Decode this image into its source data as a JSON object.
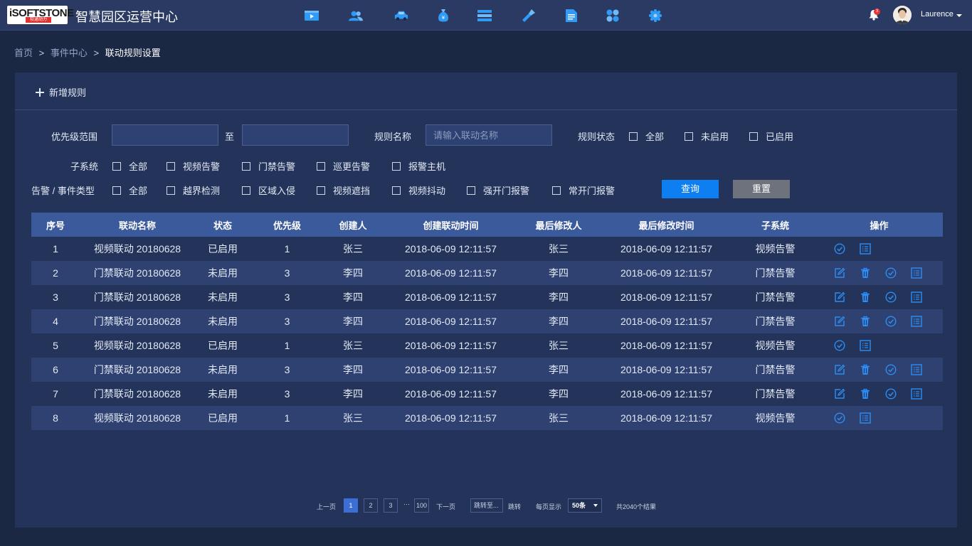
{
  "header": {
    "logo_text": "iSOFTSTONE",
    "logo_sub": "软通动力",
    "app_title": "智慧园区运营中心",
    "nav_icons": [
      "video-icon",
      "users-icon",
      "car-icon",
      "money-bag-icon",
      "layers-icon",
      "tool-icon",
      "document-icon",
      "apps-icon",
      "settings-icon"
    ],
    "notification_count": "3",
    "username": "Laurence"
  },
  "breadcrumb": {
    "home": "首页",
    "sep1": ">",
    "events": "事件中心",
    "sep2": ">",
    "current": "联动规则设置"
  },
  "toolbar": {
    "add_rule": "新增规则"
  },
  "filters": {
    "priority_label": "优先级范围",
    "priority_to": "至",
    "priority_from_value": "",
    "priority_to_value": "",
    "rule_name_label": "规则名称",
    "rule_name_placeholder": "请输入联动名称",
    "rule_status_label": "规则状态",
    "status_options": [
      "全部",
      "未启用",
      "已启用"
    ],
    "subsystem_label": "子系统",
    "subsystem_options": [
      "全部",
      "视频告警",
      "门禁告警",
      "巡更告警",
      "报警主机"
    ],
    "alarm_type_label": "告警 / 事件类型",
    "alarm_type_options": [
      "全部",
      "越界检测",
      "区域入侵",
      "视频遮挡",
      "视频抖动",
      "强开门报警",
      "常开门报警"
    ],
    "query_button": "查询",
    "reset_button": "重置"
  },
  "table": {
    "columns": [
      "序号",
      "联动名称",
      "状态",
      "优先级",
      "创建人",
      "创建联动时间",
      "最后修改人",
      "最后修改时间",
      "子系统",
      "操作"
    ],
    "rows": [
      {
        "no": "1",
        "name": "视频联动 20180628",
        "status": "已启用",
        "priority": "1",
        "creator": "张三",
        "created": "2018-06-09 12:11:57",
        "modifier": "张三",
        "modified": "2018-06-09 12:11:57",
        "subsystem": "视频告警",
        "ops": [
          "check-circle-icon",
          "list-icon"
        ]
      },
      {
        "no": "2",
        "name": "门禁联动 20180628",
        "status": "未启用",
        "priority": "3",
        "creator": "李四",
        "created": "2018-06-09 12:11:57",
        "modifier": "李四",
        "modified": "2018-06-09 12:11:57",
        "subsystem": "门禁告警",
        "ops": [
          "edit-icon",
          "trash-icon",
          "check-circle-icon",
          "list-icon"
        ]
      },
      {
        "no": "3",
        "name": "门禁联动 20180628",
        "status": "未启用",
        "priority": "3",
        "creator": "李四",
        "created": "2018-06-09 12:11:57",
        "modifier": "李四",
        "modified": "2018-06-09 12:11:57",
        "subsystem": "门禁告警",
        "ops": [
          "edit-icon",
          "trash-icon",
          "check-circle-icon",
          "list-icon"
        ]
      },
      {
        "no": "4",
        "name": "门禁联动 20180628",
        "status": "未启用",
        "priority": "3",
        "creator": "李四",
        "created": "2018-06-09 12:11:57",
        "modifier": "李四",
        "modified": "2018-06-09 12:11:57",
        "subsystem": "门禁告警",
        "ops": [
          "edit-icon",
          "trash-icon",
          "check-circle-icon",
          "list-icon"
        ]
      },
      {
        "no": "5",
        "name": "视频联动 20180628",
        "status": "已启用",
        "priority": "1",
        "creator": "张三",
        "created": "2018-06-09 12:11:57",
        "modifier": "张三",
        "modified": "2018-06-09 12:11:57",
        "subsystem": "视频告警",
        "ops": [
          "check-circle-icon",
          "list-icon"
        ]
      },
      {
        "no": "6",
        "name": "门禁联动 20180628",
        "status": "未启用",
        "priority": "3",
        "creator": "李四",
        "created": "2018-06-09 12:11:57",
        "modifier": "李四",
        "modified": "2018-06-09 12:11:57",
        "subsystem": "门禁告警",
        "ops": [
          "edit-icon",
          "trash-icon",
          "check-circle-icon",
          "list-icon"
        ]
      },
      {
        "no": "7",
        "name": "门禁联动 20180628",
        "status": "未启用",
        "priority": "3",
        "creator": "李四",
        "created": "2018-06-09 12:11:57",
        "modifier": "李四",
        "modified": "2018-06-09 12:11:57",
        "subsystem": "门禁告警",
        "ops": [
          "edit-icon",
          "trash-icon",
          "check-circle-icon",
          "list-icon"
        ]
      },
      {
        "no": "8",
        "name": "视频联动 20180628",
        "status": "已启用",
        "priority": "1",
        "creator": "张三",
        "created": "2018-06-09 12:11:57",
        "modifier": "张三",
        "modified": "2018-06-09 12:11:57",
        "subsystem": "视频告警",
        "ops": [
          "check-circle-icon",
          "list-icon"
        ]
      }
    ]
  },
  "pagination": {
    "prev": "上一页",
    "pages": [
      "1",
      "2",
      "3"
    ],
    "active_page": "1",
    "ellipsis": "···",
    "last_page": "100",
    "next": "下一页",
    "jump_placeholder": "跳转至...",
    "jump": "跳转",
    "per_page_label": "每页显示",
    "per_page_value": "50条",
    "total": "共2040个结果"
  },
  "colors": {
    "background": "#1b2844",
    "topbar": "#2a3a63",
    "panel": "#23335a",
    "table_header": "#3b5a9c",
    "accent_blue": "#0d7ff0",
    "icon_blue": "#2c8df4",
    "reset_gray": "#6e727c",
    "badge_red": "#e33333"
  }
}
